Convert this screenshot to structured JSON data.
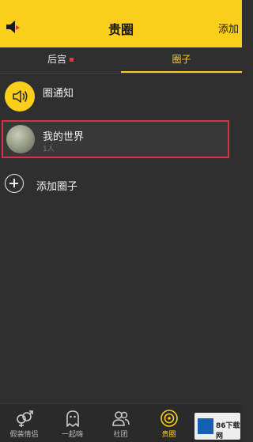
{
  "header": {
    "title": "贵圈",
    "add_label": "添加",
    "accent": "#f9cf1b"
  },
  "tabs": [
    {
      "label": "后宫",
      "has_dot": true
    },
    {
      "label": "圈子",
      "active": true
    }
  ],
  "notice": {
    "label": "圈通知",
    "icon": "speaker-icon"
  },
  "circles": [
    {
      "name": "我的世界",
      "count": "1人"
    }
  ],
  "add_circle": {
    "label": "添加圈子",
    "icon": "plus-circle-icon"
  },
  "bottom_nav": [
    {
      "label": "假装情侣",
      "icon": "gender-couple-icon"
    },
    {
      "label": "一起嗨",
      "icon": "ghost-icon"
    },
    {
      "label": "社团",
      "icon": "people-icon"
    },
    {
      "label": "贵圈",
      "icon": "circle-target-icon",
      "active": true
    }
  ],
  "watermark": {
    "text": "86下载网"
  }
}
